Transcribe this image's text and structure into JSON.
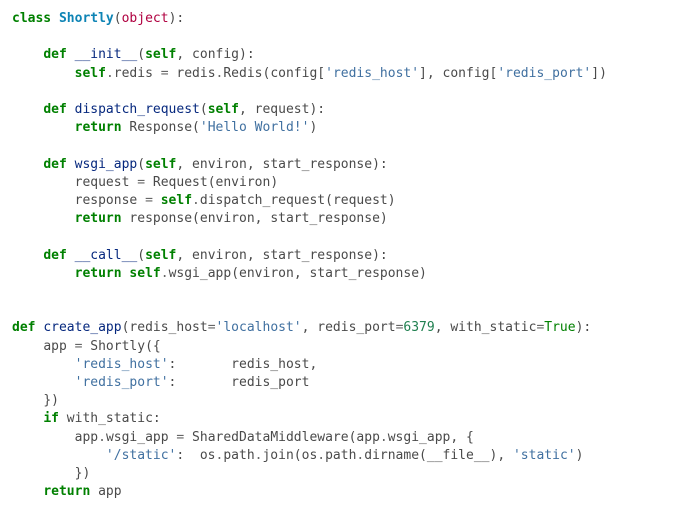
{
  "code": {
    "class_kw": "class",
    "class_name": "Shortly",
    "object_kw": "object",
    "def_kw": "def",
    "self_kw": "self",
    "return_kw": "return",
    "if_kw": "if",
    "init_name": "__init__",
    "init_param": "config",
    "init_line_self_redis": "self",
    "init_dot": ".",
    "init_attr_redis": "redis",
    "init_eq": "=",
    "init_redis_mod": "redis",
    "init_Redis": "Redis",
    "init_cfg": "config",
    "init_key_host": "'redis_host'",
    "init_key_port": "'redis_port'",
    "dispatch_name": "dispatch_request",
    "dispatch_param": "request",
    "dispatch_Response": "Response",
    "dispatch_str": "'Hello World!'",
    "wsgi_name": "wsgi_app",
    "wsgi_param1": "environ",
    "wsgi_param2": "start_response",
    "wsgi_Request": "Request",
    "wsgi_request": "request",
    "wsgi_response": "response",
    "wsgi_dispatch": "dispatch_request",
    "call_name": "__call__",
    "call_param1": "environ",
    "call_param2": "start_response",
    "call_wsgi": "wsgi_app",
    "create_name": "create_app",
    "create_p1": "redis_host",
    "create_d1": "'localhost'",
    "create_p2": "redis_port",
    "create_d2": "6379",
    "create_p3": "with_static",
    "create_d3": "True",
    "create_app_var": "app",
    "create_Shortly": "Shortly",
    "create_key_host": "'redis_host'",
    "create_val_host": "redis_host",
    "create_key_port": "'redis_port'",
    "create_val_port": "redis_port",
    "create_with_static": "with_static",
    "create_SharedData": "SharedDataMiddleware",
    "create_static_key": "'/static'",
    "create_os": "os",
    "create_path": "path",
    "create_join": "join",
    "create_dirname": "dirname",
    "create_file": "__file__",
    "create_static_str": "'static'",
    "create_ret_app": "app"
  }
}
